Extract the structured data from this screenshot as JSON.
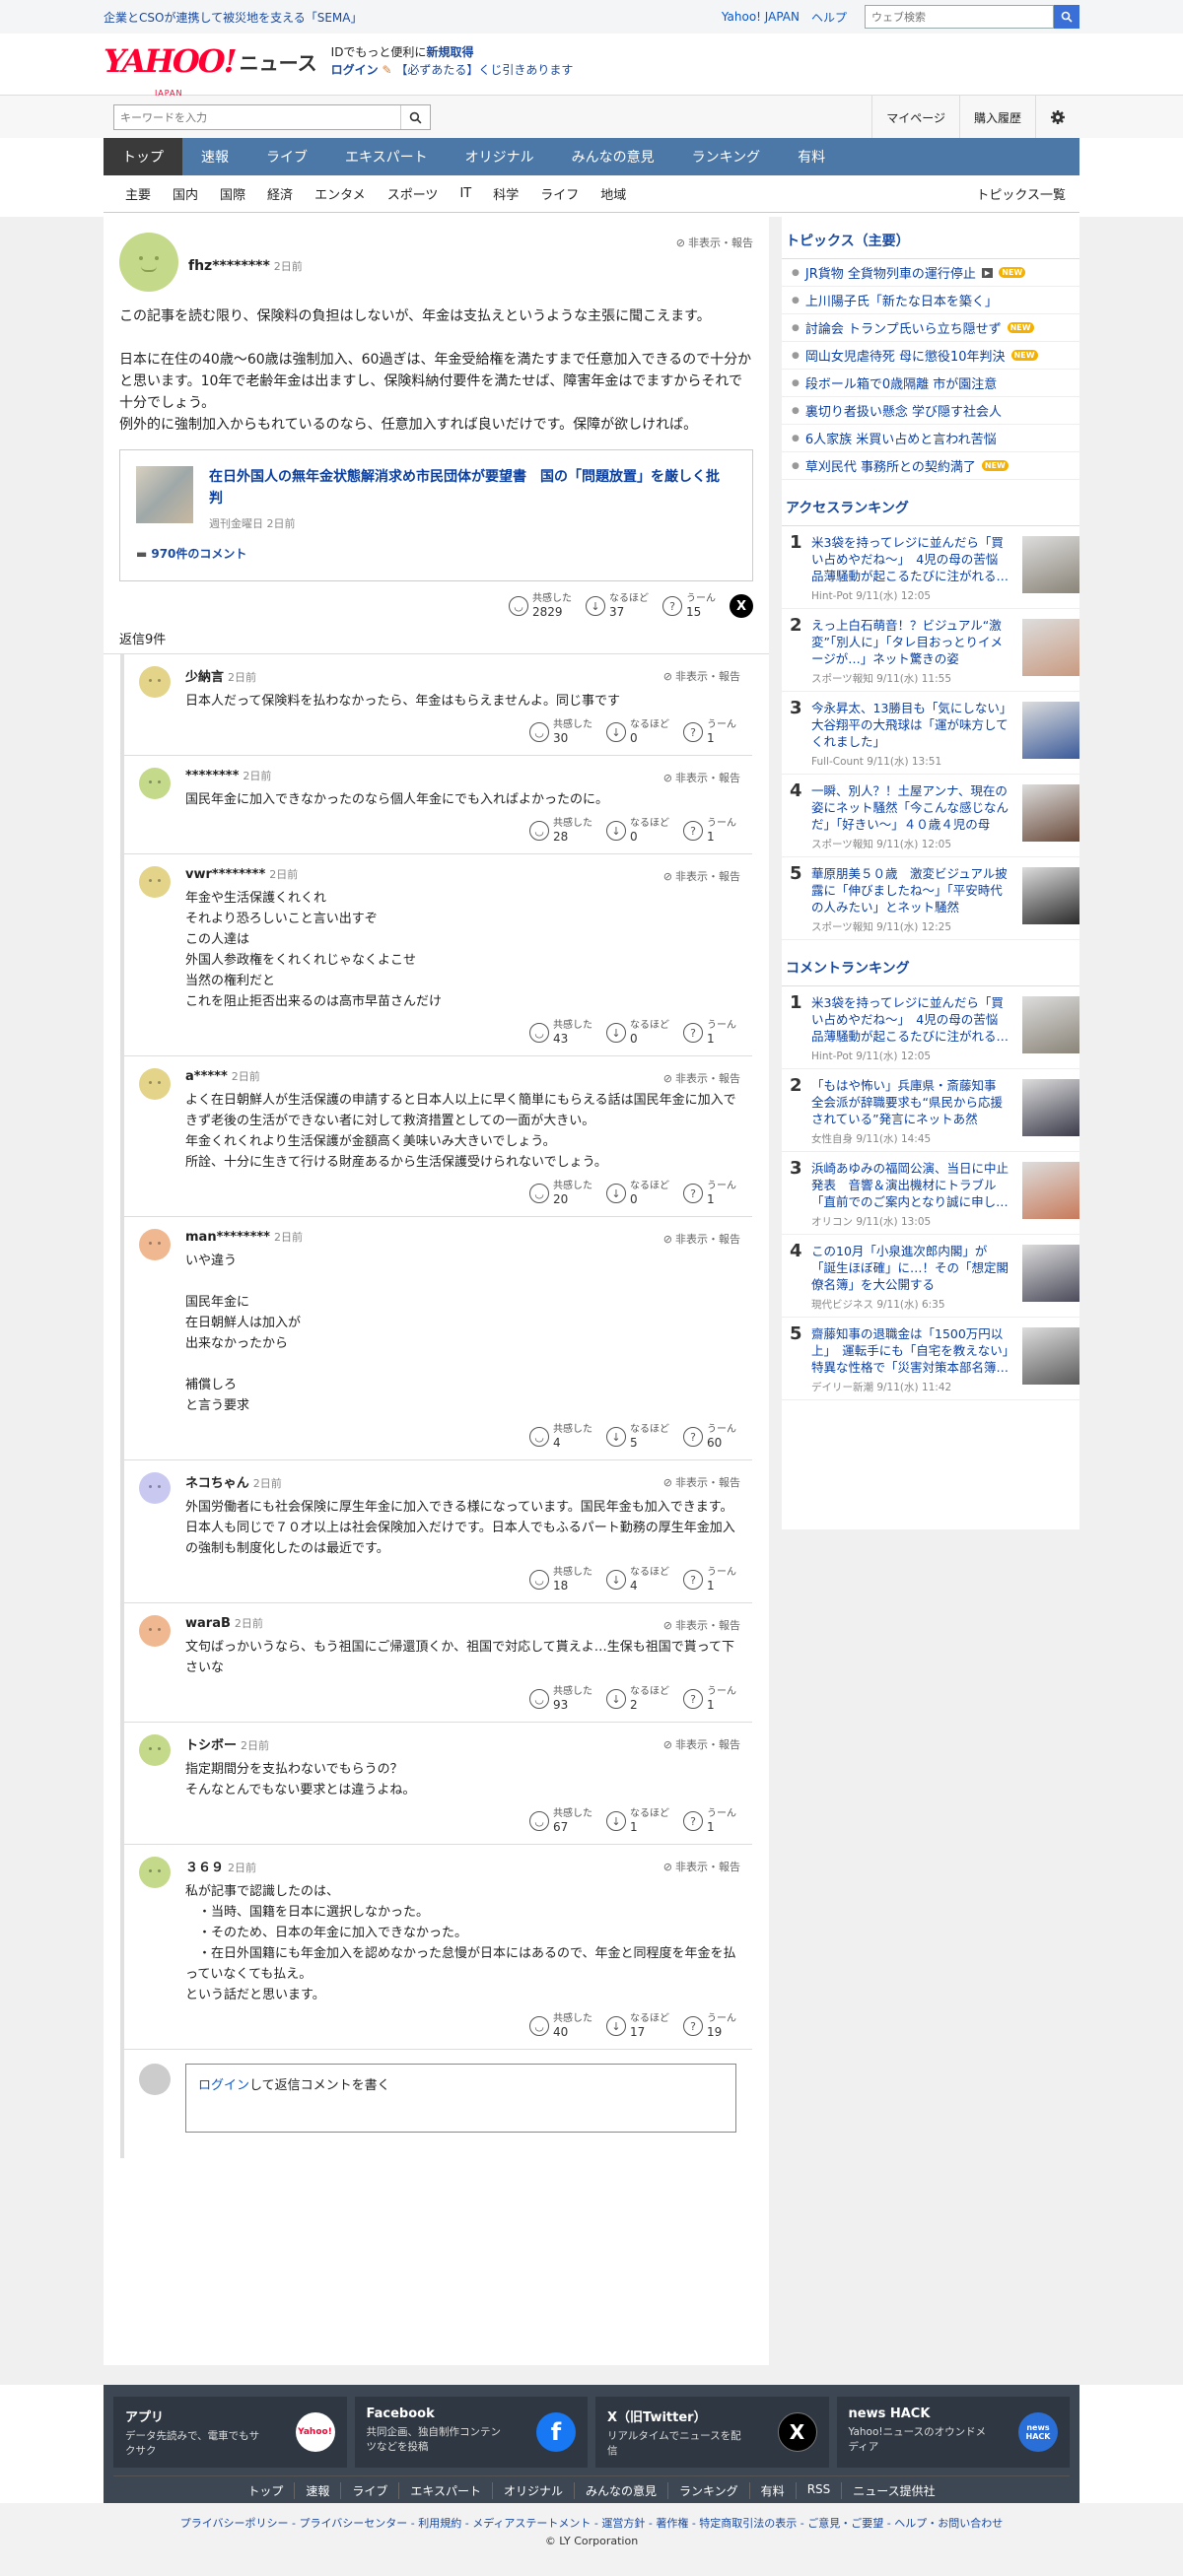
{
  "topbar": {
    "promo": "企業とCSOが連携して被災地を支える「SEMA」",
    "yahoo_japan": "Yahoo! JAPAN",
    "help": "ヘルプ",
    "search_placeholder": "ウェブ検索"
  },
  "header": {
    "logo": "YAHOO!",
    "logo_sub": "JAPAN",
    "news": "ニュース",
    "msg_line1_prefix": "IDでもっと便利に",
    "msg_line1_link": "新規取得",
    "msg_line2_login": "ログイン",
    "msg_line2_rest": "【必ずあたる】くじ引きあります"
  },
  "searchrow": {
    "placeholder": "キーワードを入力",
    "mypage": "マイページ",
    "history": "購入履歴"
  },
  "gnav": [
    "トップ",
    "速報",
    "ライブ",
    "エキスパート",
    "オリジナル",
    "みんなの意見",
    "ランキング",
    "有料"
  ],
  "subnav": [
    "主要",
    "国内",
    "国際",
    "経済",
    "エンタメ",
    "スポーツ",
    "IT",
    "科学",
    "ライフ",
    "地域"
  ],
  "subnav_all": "トピックス一覧",
  "labels": {
    "hide_report": "非表示・報告",
    "agree": "共感した",
    "naruhodo": "なるほど",
    "uun": "うーん",
    "reply_login": "ログイン",
    "reply_prompt": "して返信コメントを書く"
  },
  "root": {
    "name": "fhz********",
    "time": "2日前",
    "body": "この記事を読む限り、保険料の負担はしないが、年金は支払えというような主張に聞こえます。\n\n日本に在住の40歳〜60歳は強制加入、60過ぎは、年金受給権を満たすまで任意加入できるので十分かと思います。10年で老齢年金は出ますし、保険料納付要件を満たせば、障害年金はでますからそれで十分でしょう。\n例外的に強制加入からもれているのなら、任意加入すれば良いだけです。保障が欲しければ。",
    "article_title": "在日外国人の無年金状態解消求め市民団体が要望書　国の「問題放置」を厳しく批判",
    "article_src": "週刊金曜日 2日前",
    "article_comments": "970件のコメント",
    "agree": "2829",
    "naruhodo": "37",
    "uun": "15",
    "replies_count": "返信9件"
  },
  "replies": [
    {
      "name": "少納言",
      "time": "2日前",
      "body": "日本人だって保険料を払わなかったら、年金はもらえませんよ。同じ事です",
      "agree": "30",
      "naruhodo": "0",
      "uun": "1",
      "color": "#e3d48a"
    },
    {
      "name": "********",
      "time": "2日前",
      "body": "国民年金に加入できなかったのなら個人年金にでも入ればよかったのに。",
      "agree": "28",
      "naruhodo": "0",
      "uun": "1",
      "color": "#c4d98a"
    },
    {
      "name": "vwr********",
      "time": "2日前",
      "body": "年金や生活保護くれくれ\nそれより恐ろしいこと言い出すぞ\nこの人達は\n外国人参政権をくれくれじゃなくよこせ\n当然の権利だと\nこれを阻止拒否出来るのは高市早苗さんだけ",
      "agree": "43",
      "naruhodo": "0",
      "uun": "1",
      "color": "#e3d48a"
    },
    {
      "name": "a*****",
      "time": "2日前",
      "body": "よく在日朝鮮人が生活保護の申請すると日本人以上に早く簡単にもらえる話は国民年金に加入できず老後の生活ができない者に対して救済措置としての一面が大きい。\n年金くれくれより生活保護が金額高く美味いみ大きいでしょう。\n所詮、十分に生きて行ける財産あるから生活保護受けられないでしょう。",
      "agree": "20",
      "naruhodo": "0",
      "uun": "1",
      "color": "#e3d48a"
    },
    {
      "name": "man********",
      "time": "2日前",
      "body": "いや違う\n\n国民年金に\n在日朝鮮人は加入が\n出来なかったから\n\n補償しろ\nと言う要求",
      "agree": "4",
      "naruhodo": "5",
      "uun": "60",
      "color": "#f0b890"
    },
    {
      "name": "ネコちゃん",
      "time": "2日前",
      "body": "外国労働者にも社会保険に厚生年金に加入できる様になっています。国民年金も加入できます。日本人も同じで７０才以上は社会保険加入だけです。日本人でもふるパート勤務の厚生年金加入の強制も制度化したのは最近です。",
      "agree": "18",
      "naruhodo": "4",
      "uun": "1",
      "color": "#c8c8f0"
    },
    {
      "name": "waraB",
      "time": "2日前",
      "body": "文句ばっかいうなら、もう祖国にご帰還頂くか、祖国で対応して貰えよ…生保も祖国で貰って下さいな",
      "agree": "93",
      "naruhodo": "2",
      "uun": "1",
      "color": "#f0b890"
    },
    {
      "name": "トシボー",
      "time": "2日前",
      "body": "指定期間分を支払わないでもらうの？\nそんなとんでもない要求とは違うよね。",
      "agree": "67",
      "naruhodo": "1",
      "uun": "1",
      "color": "#c4d98a"
    },
    {
      "name": "３６９",
      "time": "2日前",
      "body": "私が記事で認識したのは、\n　・当時、国籍を日本に選択しなかった。\n　・そのため、日本の年金に加入できなかった。\n　・在日外国籍にも年金加入を認めなかった怠慢が日本にはあるので、年金と同程度を年金を払っていなくても払え。\nという話だと思います。",
      "agree": "40",
      "naruhodo": "17",
      "uun": "19",
      "color": "#c4d98a"
    }
  ],
  "topics": {
    "heading": "トピックス（主要）",
    "items": [
      {
        "text": "JR貨物 全貨物列車の運行停止",
        "play": true,
        "new": true
      },
      {
        "text": "上川陽子氏「新たな日本を築く」",
        "play": false,
        "new": false
      },
      {
        "text": "討論会 トランプ氏いら立ち隠せず",
        "play": false,
        "new": true
      },
      {
        "text": "岡山女児虐待死 母に懲役10年判決",
        "play": false,
        "new": true
      },
      {
        "text": "段ボール箱で0歳隔離 市が園注意",
        "play": false,
        "new": false
      },
      {
        "text": "裏切り者扱い懸念 学び隠す社会人",
        "play": false,
        "new": false
      },
      {
        "text": "6人家族 米買い占めと言われ苦悩",
        "play": false,
        "new": false
      },
      {
        "text": "草刈民代 事務所との契約満了",
        "play": false,
        "new": true
      }
    ],
    "play_label": "▶",
    "new_label": "NEW"
  },
  "access_ranking": {
    "heading": "アクセスランキング",
    "items": [
      {
        "n": "1",
        "title": "米3袋を持ってレジに並んだら「買い占めやだね〜」　4児の母の苦悩　品薄騒動が起こるたびに注がれる冷めた目",
        "meta": "Hint-Pot 9/11(水) 12:05",
        "color": "#8a8478"
      },
      {
        "n": "2",
        "title": "えっ上白石萌音！？ビジュアル“激変”「別人に」「タレ目おっとりイメージが…」ネット驚きの姿",
        "meta": "スポーツ報知 9/11(水) 11:55",
        "color": "#c99a80"
      },
      {
        "n": "3",
        "title": "今永昇太、13勝目も「気にしない」　大谷翔平の大飛球は「運が味方してくれました」",
        "meta": "Full-Count 9/11(水) 13:51",
        "color": "#3a5a9a"
      },
      {
        "n": "4",
        "title": "一瞬、別人？！土屋アンナ、現在の姿にネット騒然「今こんな感じなんだ」「好きい〜」４０歳４児の母",
        "meta": "スポーツ報知 9/11(水) 12:05",
        "color": "#6a4a3a"
      },
      {
        "n": "5",
        "title": "華原朋美５０歳　激変ビジュアル披露に「伸びましたね〜」「平安時代の人みたい」とネット騒然",
        "meta": "スポーツ報知 9/11(水) 12:25",
        "color": "#2a2a2a"
      }
    ]
  },
  "comment_ranking": {
    "heading": "コメントランキング",
    "items": [
      {
        "n": "1",
        "title": "米3袋を持ってレジに並んだら「買い占めやだね〜」　4児の母の苦悩　品薄騒動が起こるたびに注がれる冷めた目",
        "meta": "Hint-Pot 9/11(水) 12:05",
        "color": "#8a8478"
      },
      {
        "n": "2",
        "title": "「もはや怖い」兵庫県・斎藤知事　全会派が辞職要求も“県民から応援されている”発言にネットあ然",
        "meta": "女性自身 9/11(水) 14:45",
        "color": "#3a3a4a"
      },
      {
        "n": "3",
        "title": "浜崎あゆみの福岡公演、当日に中止発表　音響＆演出機材にトラブル「直前でのご案内となり誠に申し訳ございません」",
        "meta": "オリコン 9/11(水) 13:05",
        "color": "#c87a5a"
      },
      {
        "n": "4",
        "title": "この10月「小泉進次郎内閣」が「誕生ほぼ確」に…！その「想定閣僚名簿」を大公開する",
        "meta": "現代ビジネス 9/11(水) 6:35",
        "color": "#4a4a5a"
      },
      {
        "n": "5",
        "title": "齋藤知事の退職金は「1500万円以上」　運転手にも「自宅を教えない」特異な性格で「災害対策本部名簿も空白に」",
        "meta": "デイリー新潮 9/11(水) 11:42",
        "color": "#5a5a5a"
      }
    ]
  },
  "footer": {
    "cards": [
      {
        "title": "アプリ",
        "desc": "データ先読みで、電車でもサクサク",
        "icon_text": "Yahoo!"
      },
      {
        "title": "Facebook",
        "desc": "共同企画、独自制作コンテンツなどを投稿",
        "icon_text": "f"
      },
      {
        "title": "X（旧Twitter）",
        "desc": "リアルタイムでニュースを配信",
        "icon_text": "X"
      },
      {
        "title": "news HACK",
        "desc": "Yahoo!ニュースのオウンドメディア",
        "icon_text": "news HACK"
      }
    ],
    "nav": [
      "トップ",
      "速報",
      "ライブ",
      "エキスパート",
      "オリジナル",
      "みんなの意見",
      "ランキング",
      "有料",
      "RSS",
      "ニュース提供社"
    ],
    "links": "プライバシーポリシー - プライバシーセンター - 利用規約 - メディアステートメント - 運営方針 - 著作権 - 特定商取引法の表示 - ご意見・ご要望 - ヘルプ・お問い合わせ",
    "copyright": "© LY Corporation"
  }
}
